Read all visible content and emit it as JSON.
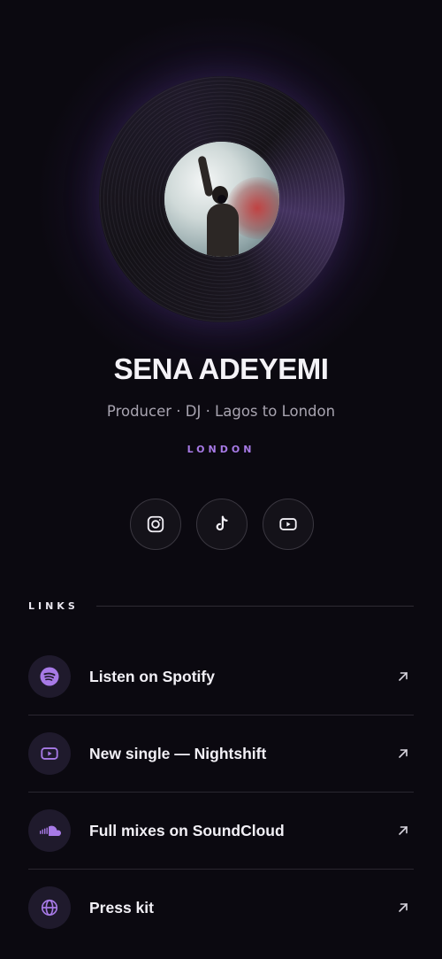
{
  "profile": {
    "name": "SENA ADEYEMI",
    "tagline": "Producer · DJ · Lagos to London",
    "location": "LONDON"
  },
  "socials": [
    {
      "icon": "instagram-icon"
    },
    {
      "icon": "tiktok-icon"
    },
    {
      "icon": "youtube-icon"
    }
  ],
  "links": {
    "title": "LINKS",
    "items": [
      {
        "label": "Listen on Spotify",
        "icon": "spotify-icon"
      },
      {
        "label": "New single — Nightshift",
        "icon": "youtube-icon"
      },
      {
        "label": "Full mixes on SoundCloud",
        "icon": "soundcloud-icon"
      },
      {
        "label": "Press kit",
        "icon": "globe-icon"
      }
    ]
  },
  "colors": {
    "background": "#0b0910",
    "accent": "#a77ae6",
    "icon_bg": "#1f1a2c"
  }
}
